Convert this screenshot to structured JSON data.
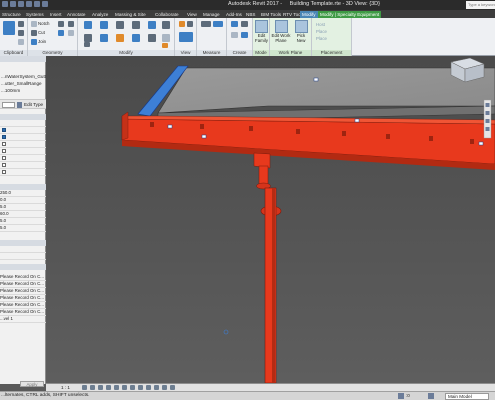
{
  "app": {
    "title": "Autodesk Revit 2017 -",
    "document": "Building Template.rte - 3D View: {3D}",
    "search_placeholder": "Type a keyword"
  },
  "tabs": [
    {
      "label": "Structure"
    },
    {
      "label": "Systems"
    },
    {
      "label": "Insert"
    },
    {
      "label": "Annotate"
    },
    {
      "label": "Analyze"
    },
    {
      "label": "Massing & Site"
    },
    {
      "label": "Collaborate"
    },
    {
      "label": "View"
    },
    {
      "label": "Manage"
    },
    {
      "label": "Add-Ins"
    },
    {
      "label": "NBS"
    },
    {
      "label": "BIM Tools"
    },
    {
      "label": "RTV Tools"
    },
    {
      "label": "Modify"
    },
    {
      "label": "Modify | Specialty Equipment"
    }
  ],
  "ribbon": {
    "groups": [
      {
        "label": "Clipboard"
      },
      {
        "label": "Geometry"
      },
      {
        "label": "Modify"
      },
      {
        "label": "View"
      },
      {
        "label": "Measure"
      },
      {
        "label": "Create"
      },
      {
        "label": "Mode"
      },
      {
        "label": "Work Plane"
      },
      {
        "label": "Placement"
      }
    ],
    "geometry_labels": [
      "Notch",
      "Cut",
      "Join"
    ],
    "edit_family": "Edit Family",
    "edit_work_plane": "Edit Work Plane",
    "pick_new": "Pick New",
    "placement_items": [
      "Host",
      "Place",
      "Place"
    ]
  },
  "properties": {
    "type_line1": "...nWaterSystem_Gutter",
    "type_line2": "...utter_SmallRange",
    "type_line3": "...100mm",
    "edit_type": "Edit Type",
    "values": [
      "250.0",
      "0.0",
      "5.0",
      "60.0",
      "5.0",
      "5.0"
    ],
    "record_rows": [
      "Please Record On C...",
      "Please Record On C...",
      "Please Record On C...",
      "Please Record On C...",
      "Please Record On C...",
      "Please Record On C..."
    ],
    "level": "...vel 1",
    "apply": "Apply"
  },
  "viewbar": {
    "scale": "1 : 1"
  },
  "status": {
    "hint": "...lternates, CTRL adds, SHIFT unselects.",
    "model": "Main Model",
    "ws_count": ":0"
  },
  "colors": {
    "gutter_red": "#e8391d",
    "selection_blue": "#3d7fd6",
    "roof_gray": "#8f8f8f",
    "ribbon_context": "#3f9a45"
  }
}
